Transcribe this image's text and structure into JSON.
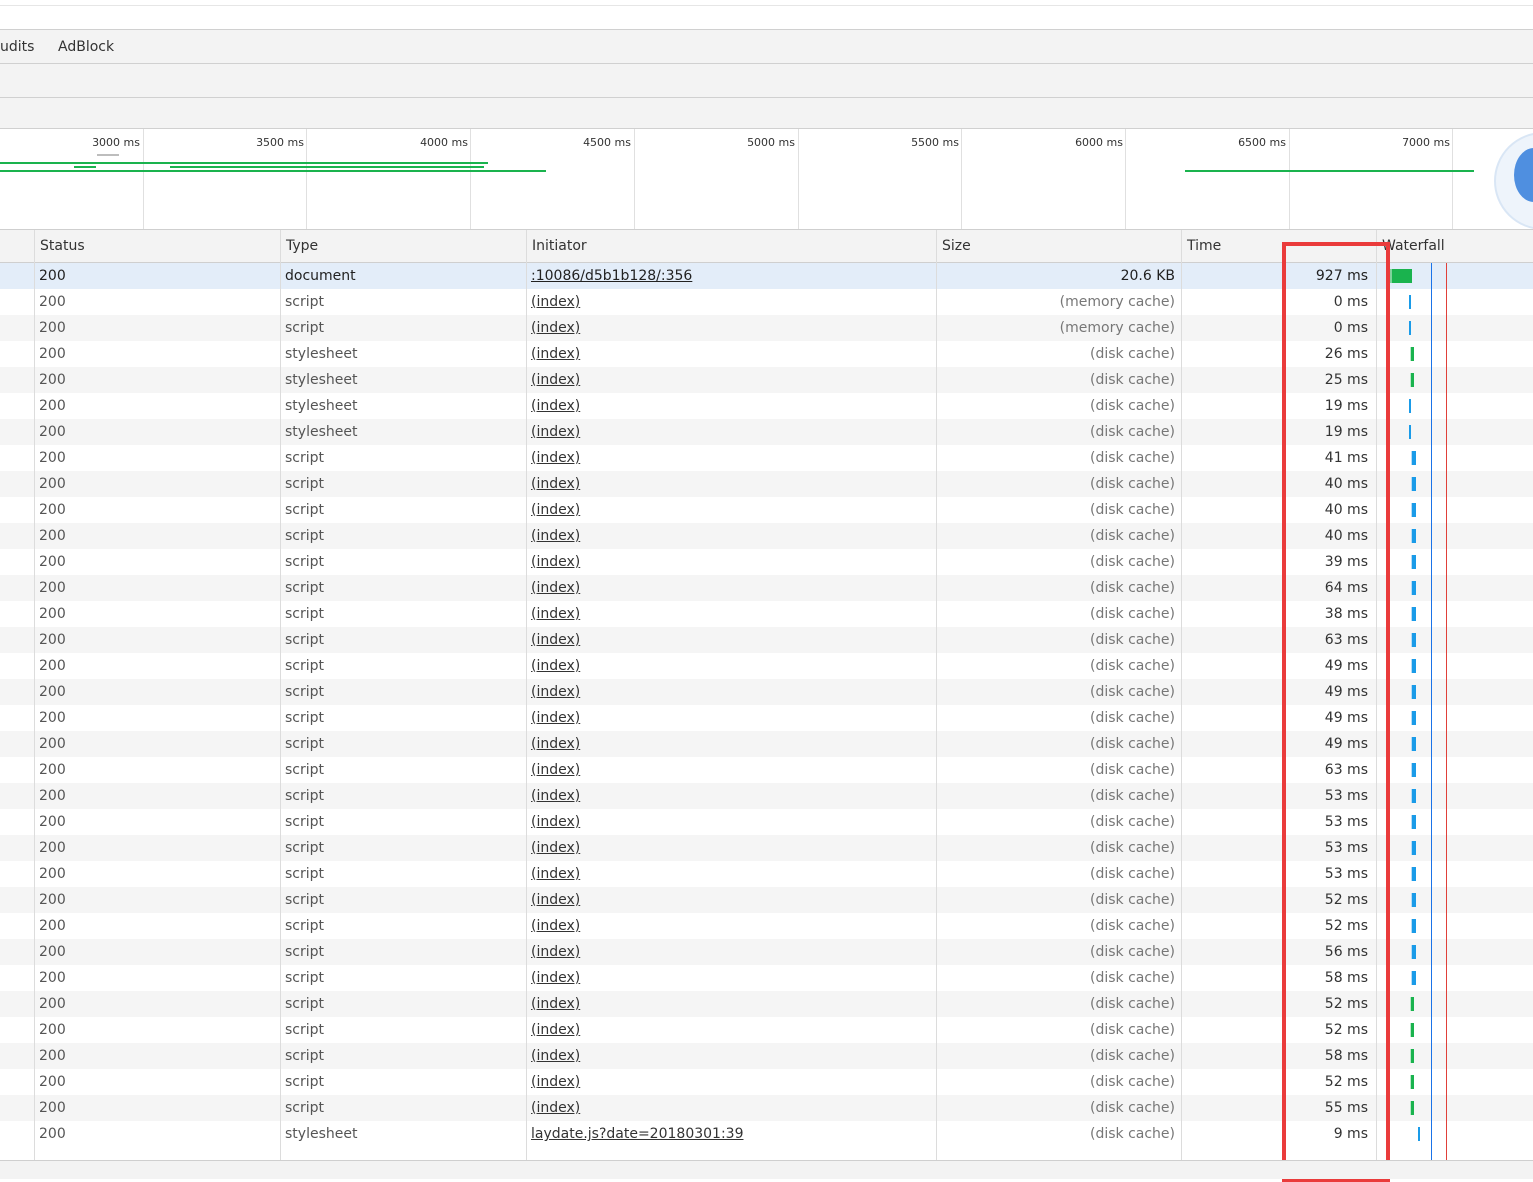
{
  "tabs": [
    {
      "label": "udits"
    },
    {
      "label": "AdBlock"
    }
  ],
  "overview": {
    "ticks": [
      "3000 ms",
      "3500 ms",
      "4000 ms",
      "4500 ms",
      "5000 ms",
      "5500 ms",
      "6000 ms",
      "6500 ms",
      "7000 ms"
    ]
  },
  "table": {
    "headers": {
      "status": "Status",
      "type": "Type",
      "initiator": "Initiator",
      "size": "Size",
      "time": "Time",
      "waterfall": "Waterfall"
    },
    "rows": [
      {
        "status": "200",
        "type": "document",
        "initiator": ":10086/d5b1b128/:356",
        "size": "20.6 KB",
        "time": "927 ms",
        "wf": "doc"
      },
      {
        "status": "200",
        "type": "script",
        "initiator": "(index)",
        "size": "(memory cache)",
        "time": "0 ms",
        "wf": "tick"
      },
      {
        "status": "200",
        "type": "script",
        "initiator": "(index)",
        "size": "(memory cache)",
        "time": "0 ms",
        "wf": "tick"
      },
      {
        "status": "200",
        "type": "stylesheet",
        "initiator": "(index)",
        "size": "(disk cache)",
        "time": "26 ms",
        "wf": "green"
      },
      {
        "status": "200",
        "type": "stylesheet",
        "initiator": "(index)",
        "size": "(disk cache)",
        "time": "25 ms",
        "wf": "green"
      },
      {
        "status": "200",
        "type": "stylesheet",
        "initiator": "(index)",
        "size": "(disk cache)",
        "time": "19 ms",
        "wf": "tick"
      },
      {
        "status": "200",
        "type": "stylesheet",
        "initiator": "(index)",
        "size": "(disk cache)",
        "time": "19 ms",
        "wf": "tick"
      },
      {
        "status": "200",
        "type": "script",
        "initiator": "(index)",
        "size": "(disk cache)",
        "time": "41 ms",
        "wf": "blue"
      },
      {
        "status": "200",
        "type": "script",
        "initiator": "(index)",
        "size": "(disk cache)",
        "time": "40 ms",
        "wf": "blue"
      },
      {
        "status": "200",
        "type": "script",
        "initiator": "(index)",
        "size": "(disk cache)",
        "time": "40 ms",
        "wf": "blue"
      },
      {
        "status": "200",
        "type": "script",
        "initiator": "(index)",
        "size": "(disk cache)",
        "time": "40 ms",
        "wf": "blue"
      },
      {
        "status": "200",
        "type": "script",
        "initiator": "(index)",
        "size": "(disk cache)",
        "time": "39 ms",
        "wf": "blue"
      },
      {
        "status": "200",
        "type": "script",
        "initiator": "(index)",
        "size": "(disk cache)",
        "time": "64 ms",
        "wf": "blue"
      },
      {
        "status": "200",
        "type": "script",
        "initiator": "(index)",
        "size": "(disk cache)",
        "time": "38 ms",
        "wf": "blue"
      },
      {
        "status": "200",
        "type": "script",
        "initiator": "(index)",
        "size": "(disk cache)",
        "time": "63 ms",
        "wf": "blue"
      },
      {
        "status": "200",
        "type": "script",
        "initiator": "(index)",
        "size": "(disk cache)",
        "time": "49 ms",
        "wf": "blue"
      },
      {
        "status": "200",
        "type": "script",
        "initiator": "(index)",
        "size": "(disk cache)",
        "time": "49 ms",
        "wf": "blue"
      },
      {
        "status": "200",
        "type": "script",
        "initiator": "(index)",
        "size": "(disk cache)",
        "time": "49 ms",
        "wf": "blue"
      },
      {
        "status": "200",
        "type": "script",
        "initiator": "(index)",
        "size": "(disk cache)",
        "time": "49 ms",
        "wf": "blue"
      },
      {
        "status": "200",
        "type": "script",
        "initiator": "(index)",
        "size": "(disk cache)",
        "time": "63 ms",
        "wf": "blue"
      },
      {
        "status": "200",
        "type": "script",
        "initiator": "(index)",
        "size": "(disk cache)",
        "time": "53 ms",
        "wf": "blue"
      },
      {
        "status": "200",
        "type": "script",
        "initiator": "(index)",
        "size": "(disk cache)",
        "time": "53 ms",
        "wf": "blue"
      },
      {
        "status": "200",
        "type": "script",
        "initiator": "(index)",
        "size": "(disk cache)",
        "time": "53 ms",
        "wf": "blue"
      },
      {
        "status": "200",
        "type": "script",
        "initiator": "(index)",
        "size": "(disk cache)",
        "time": "53 ms",
        "wf": "blue"
      },
      {
        "status": "200",
        "type": "script",
        "initiator": "(index)",
        "size": "(disk cache)",
        "time": "52 ms",
        "wf": "blue"
      },
      {
        "status": "200",
        "type": "script",
        "initiator": "(index)",
        "size": "(disk cache)",
        "time": "52 ms",
        "wf": "blue"
      },
      {
        "status": "200",
        "type": "script",
        "initiator": "(index)",
        "size": "(disk cache)",
        "time": "56 ms",
        "wf": "blue"
      },
      {
        "status": "200",
        "type": "script",
        "initiator": "(index)",
        "size": "(disk cache)",
        "time": "58 ms",
        "wf": "blue"
      },
      {
        "status": "200",
        "type": "script",
        "initiator": "(index)",
        "size": "(disk cache)",
        "time": "52 ms",
        "wf": "green"
      },
      {
        "status": "200",
        "type": "script",
        "initiator": "(index)",
        "size": "(disk cache)",
        "time": "52 ms",
        "wf": "green"
      },
      {
        "status": "200",
        "type": "script",
        "initiator": "(index)",
        "size": "(disk cache)",
        "time": "58 ms",
        "wf": "green"
      },
      {
        "status": "200",
        "type": "script",
        "initiator": "(index)",
        "size": "(disk cache)",
        "time": "52 ms",
        "wf": "green"
      },
      {
        "status": "200",
        "type": "script",
        "initiator": "(index)",
        "size": "(disk cache)",
        "time": "55 ms",
        "wf": "green"
      },
      {
        "status": "200",
        "type": "stylesheet",
        "initiator": "laydate.js?date=20180301:39",
        "size": "(disk cache)",
        "time": "9 ms",
        "wf": "tick"
      }
    ]
  },
  "colors": {
    "highlight": "#ea3b3b",
    "waterfall_green": "#1ab34e",
    "waterfall_blue": "#1a9be8",
    "dom_content_loaded_line": "#1a73e8",
    "load_line": "#e0403a",
    "selected_row": "#e3edf9"
  }
}
